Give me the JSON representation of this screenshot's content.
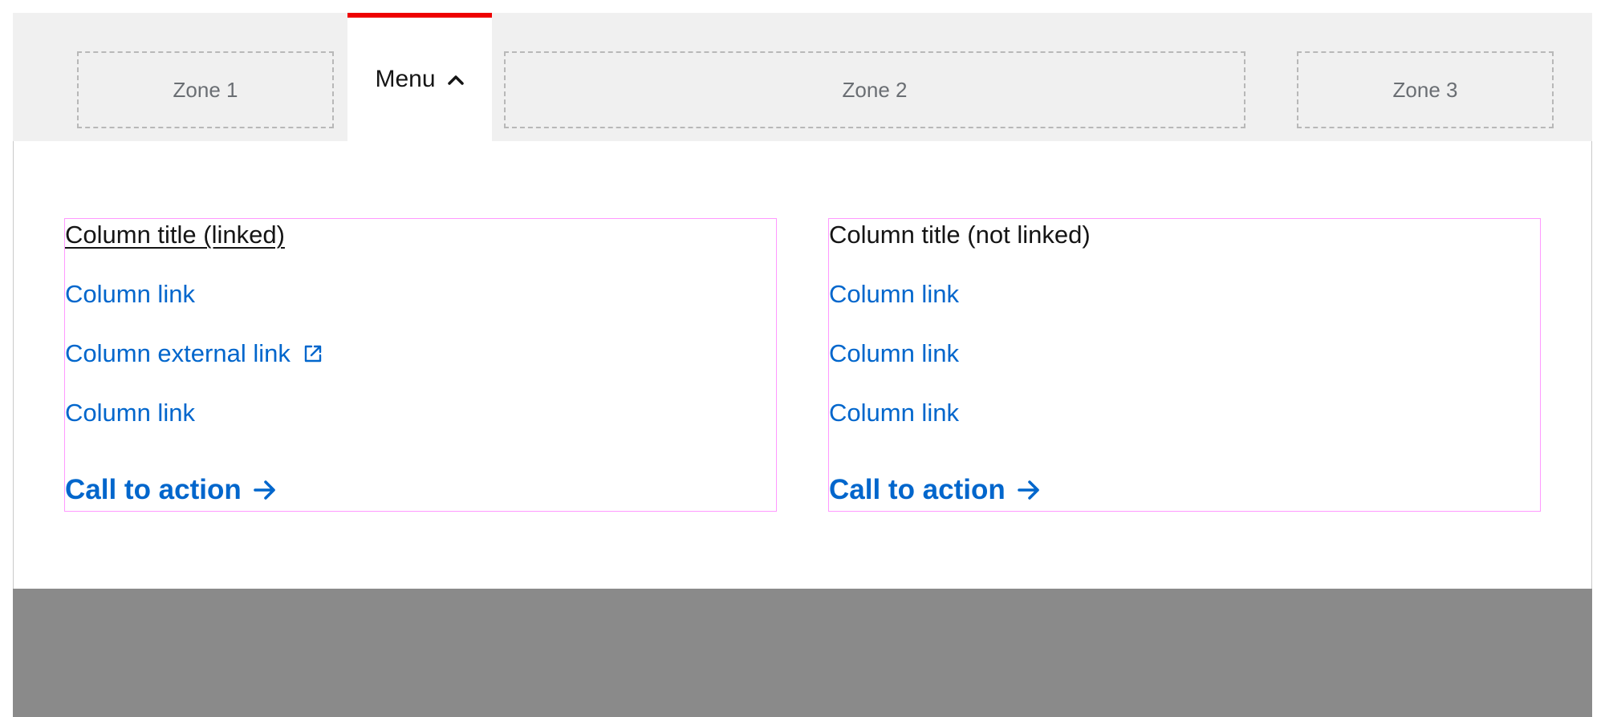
{
  "navbar": {
    "zones": [
      {
        "label": "Zone 1"
      },
      {
        "label": "Zone 2"
      },
      {
        "label": "Zone 3"
      }
    ],
    "menu": {
      "label": "Menu",
      "icon": "chevron-up-icon",
      "accent_color": "#ee0000"
    }
  },
  "columns": [
    {
      "title": "Column title (linked)",
      "title_linked": true,
      "links": [
        {
          "label": "Column link"
        },
        {
          "label": "Column external link",
          "icon": "external-link-icon"
        },
        {
          "label": "Column link"
        }
      ],
      "cta": {
        "label": "Call to action",
        "icon": "arrow-right-icon"
      }
    },
    {
      "title": "Column title (not linked)",
      "title_linked": false,
      "links": [
        {
          "label": "Column link"
        },
        {
          "label": "Column link"
        },
        {
          "label": "Column link"
        }
      ],
      "cta": {
        "label": "Call to action",
        "icon": "arrow-right-icon"
      }
    }
  ],
  "colors": {
    "link": "#0066cc",
    "nav_background": "#f0f0f0",
    "footer": "#8a8a8a"
  }
}
